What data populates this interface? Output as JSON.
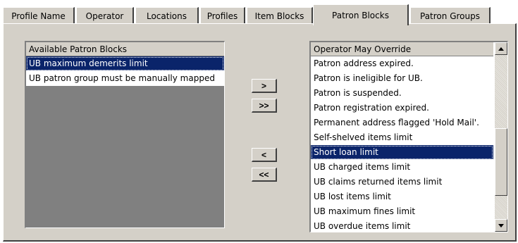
{
  "tabs": [
    {
      "label": "Profile Name"
    },
    {
      "label": "Operator"
    },
    {
      "label": "Locations"
    },
    {
      "label": "Profiles"
    },
    {
      "label": "Item Blocks"
    },
    {
      "label": "Patron Blocks"
    },
    {
      "label": "Patron Groups"
    }
  ],
  "active_tab": "Patron Blocks",
  "available": {
    "header": "Available Patron Blocks",
    "items": [
      {
        "label": "UB maximum demerits limit",
        "selected": true
      },
      {
        "label": "UB patron group must be manually mapped",
        "selected": false
      }
    ]
  },
  "buttons": {
    "add": ">",
    "add_all": ">>",
    "remove": "<",
    "remove_all": "<<"
  },
  "override": {
    "header": "Operator May Override",
    "items": [
      {
        "label": "Patron address expired.",
        "selected": false
      },
      {
        "label": "Patron is ineligible for UB.",
        "selected": false
      },
      {
        "label": "Patron is suspended.",
        "selected": false
      },
      {
        "label": "Patron registration expired.",
        "selected": false
      },
      {
        "label": "Permanent address flagged 'Hold Mail'.",
        "selected": false
      },
      {
        "label": "Self-shelved items limit",
        "selected": false
      },
      {
        "label": "Short loan limit",
        "selected": true
      },
      {
        "label": "UB charged items limit",
        "selected": false
      },
      {
        "label": "UB claims returned items limit",
        "selected": false
      },
      {
        "label": "UB lost items limit",
        "selected": false
      },
      {
        "label": "UB maximum fines limit",
        "selected": false
      },
      {
        "label": "UB overdue items limit",
        "selected": false
      }
    ]
  },
  "colors": {
    "face": "#d4d0c8",
    "selection": "#0a246a"
  }
}
